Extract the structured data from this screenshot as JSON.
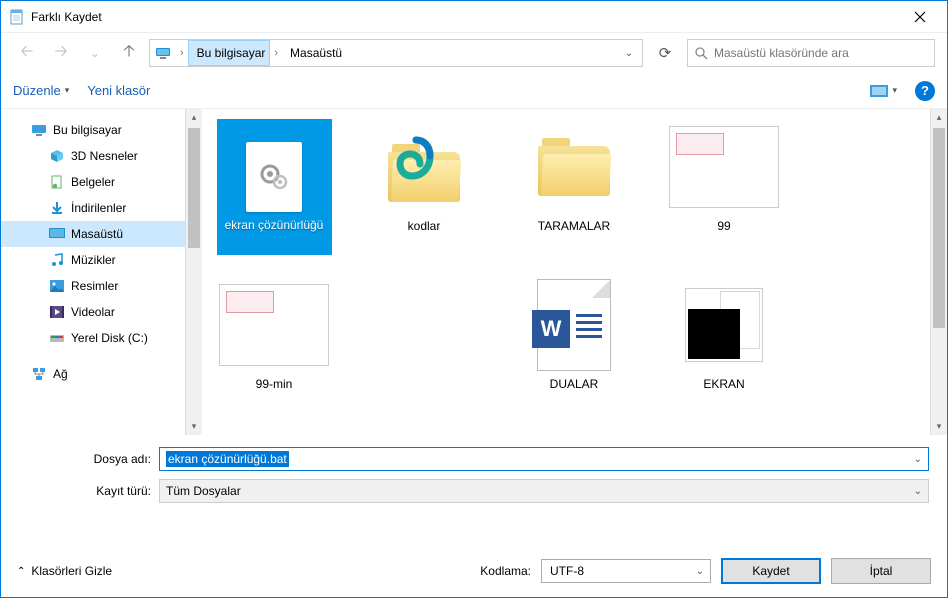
{
  "title": "Farklı Kaydet",
  "breadcrumb": {
    "root": "Bu bilgisayar",
    "current": "Masaüstü"
  },
  "search": {
    "placeholder": "Masaüstü klasöründe ara"
  },
  "toolbar": {
    "organize": "Düzenle",
    "newfolder": "Yeni klasör"
  },
  "tree": {
    "pc": "Bu bilgisayar",
    "objects3d": "3D Nesneler",
    "documents": "Belgeler",
    "downloads": "İndirilenler",
    "desktop": "Masaüstü",
    "music": "Müzikler",
    "pictures": "Resimler",
    "videos": "Videolar",
    "localdisk": "Yerel Disk (C:)",
    "network": "Ağ"
  },
  "files": {
    "selected": "ekran çözünürlüğü",
    "kodlar": "kodlar",
    "taramalar": "TARAMALAR",
    "img99": "99",
    "img99min": "99-min",
    "dualar": "DUALAR",
    "ekran": "EKRAN"
  },
  "form": {
    "filename_label": "Dosya adı:",
    "filename_value": "ekran çözünürlüğü.bat",
    "filetype_label": "Kayıt türü:",
    "filetype_value": "Tüm Dosyalar"
  },
  "bottom": {
    "hide_folders": "Klasörleri Gizle",
    "encoding_label": "Kodlama:",
    "encoding_value": "UTF-8",
    "save": "Kaydet",
    "cancel": "İptal"
  }
}
